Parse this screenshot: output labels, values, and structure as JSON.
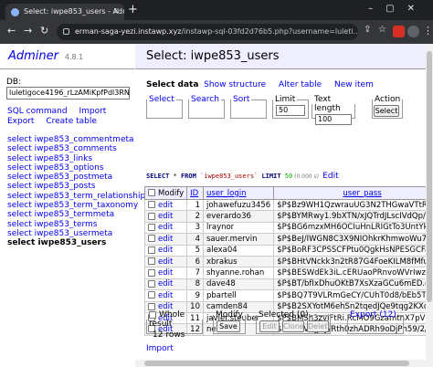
{
  "browser": {
    "tab_title": "Select: iwpe853_users - Adminer",
    "url_domain": "erman-saga-yezi.instawp.xyz",
    "url_path": "/instawp-sql-03fd2d76b5.php?username=luleti..."
  },
  "sidebar": {
    "logo": "Adminer",
    "version": "4.8.1",
    "db_label": "DB:",
    "db_value": "luletigoce4196_rLzAMiKpfPdl3RNkY0a6",
    "links": [
      "SQL command",
      "Import",
      "Export",
      "Create table"
    ],
    "select_prefix": "select",
    "tables": [
      "iwpe853_commentmeta",
      "iwpe853_comments",
      "iwpe853_links",
      "iwpe853_options",
      "iwpe853_postmeta",
      "iwpe853_posts",
      "iwpe853_term_relationships",
      "iwpe853_term_taxonomy",
      "iwpe853_termmeta",
      "iwpe853_terms",
      "iwpe853_usermeta",
      "iwpe853_users"
    ]
  },
  "main": {
    "title": "Select: iwpe853_users",
    "menu": [
      "Select data",
      "Show structure",
      "Alter table",
      "New item"
    ],
    "search_form": {
      "select": "Select",
      "search": "Search",
      "sort": "Sort",
      "limit_label": "Limit",
      "limit_value": "50",
      "text_length_label": "Text length",
      "text_length_value": "100",
      "action_label": "Action",
      "action_button": "Select"
    },
    "sql": {
      "select_kw": "SELECT",
      "star_from": " * ",
      "from_kw": "FROM",
      "table": " `iwpe853_users` ",
      "limit_kw": "LIMIT",
      "limit": " 50",
      "time": " (0.000 s)",
      "edit": "Edit"
    },
    "table": {
      "modify_header": "Modify",
      "columns": [
        "ID",
        "user_login",
        "user_pass",
        "user_n"
      ],
      "edit_label": "edit",
      "rows": [
        [
          "1",
          "johawefuzu3456",
          "$P$Bz9WH1QzwrauUG3N2THGwaVTtRn/IW/",
          "johaw"
        ],
        [
          "2",
          "everardo36",
          "$P$BYMRwy1.9bXTN/xJQTrdJLscIVdQp/1",
          "evera"
        ],
        [
          "3",
          "lraynor",
          "$P$BG6mzxMH6OCIuHnLRIGtTo3UntYkrT.",
          "lrayn"
        ],
        [
          "4",
          "sauer.mervin",
          "$P$BeJ/IWGN8C3X9NIOhkrKhmwoWu7Zq0/",
          "sauer"
        ],
        [
          "5",
          "alexa04",
          "$P$BoRF3CPSSCFPtu0QgkHsNPESGCFaPr1",
          "alexa"
        ],
        [
          "6",
          "xbrakus",
          "$P$BHtVNckk3n2tR87G4FoeKILM8fMfu6/",
          "xbrak"
        ],
        [
          "7",
          "shyanne.rohan",
          "$P$BESWdEk3iL.cERUaoPRnvoWVrIwzle1",
          "shyan"
        ],
        [
          "8",
          "dave48",
          "$P$BT/bfIxDhuOKtB7XsXzaGCu6mED.cD/",
          "dave4"
        ],
        [
          "9",
          "pbartell",
          "$P$BQ7T9VLRmGeCY/CUhT0d8/bEb5TE7v1",
          "pbart"
        ],
        [
          "10",
          "camden84",
          "$P$B2SXYotM6ehSn2tqedJQe9tqg2KXcS.",
          "camde"
        ],
        [
          "11",
          "javier.steuber",
          "$P$BMSh3zyIFtRi.RcMO9GzamtnX7pVrq1",
          "javie"
        ],
        [
          "12",
          "newuser",
          "$P$BMVUjj2y/Rth0zhADRh9oDjPh59/2/",
          "newus"
        ]
      ]
    },
    "footer": {
      "whole_result": "Whole result",
      "rows_count": "12 rows",
      "modify": "Modify",
      "save": "Save",
      "selected": "Selected (0)",
      "edit": "Edit",
      "clone": "Clone",
      "delete": "Delete",
      "export": "Export (12)",
      "import": "Import"
    }
  }
}
